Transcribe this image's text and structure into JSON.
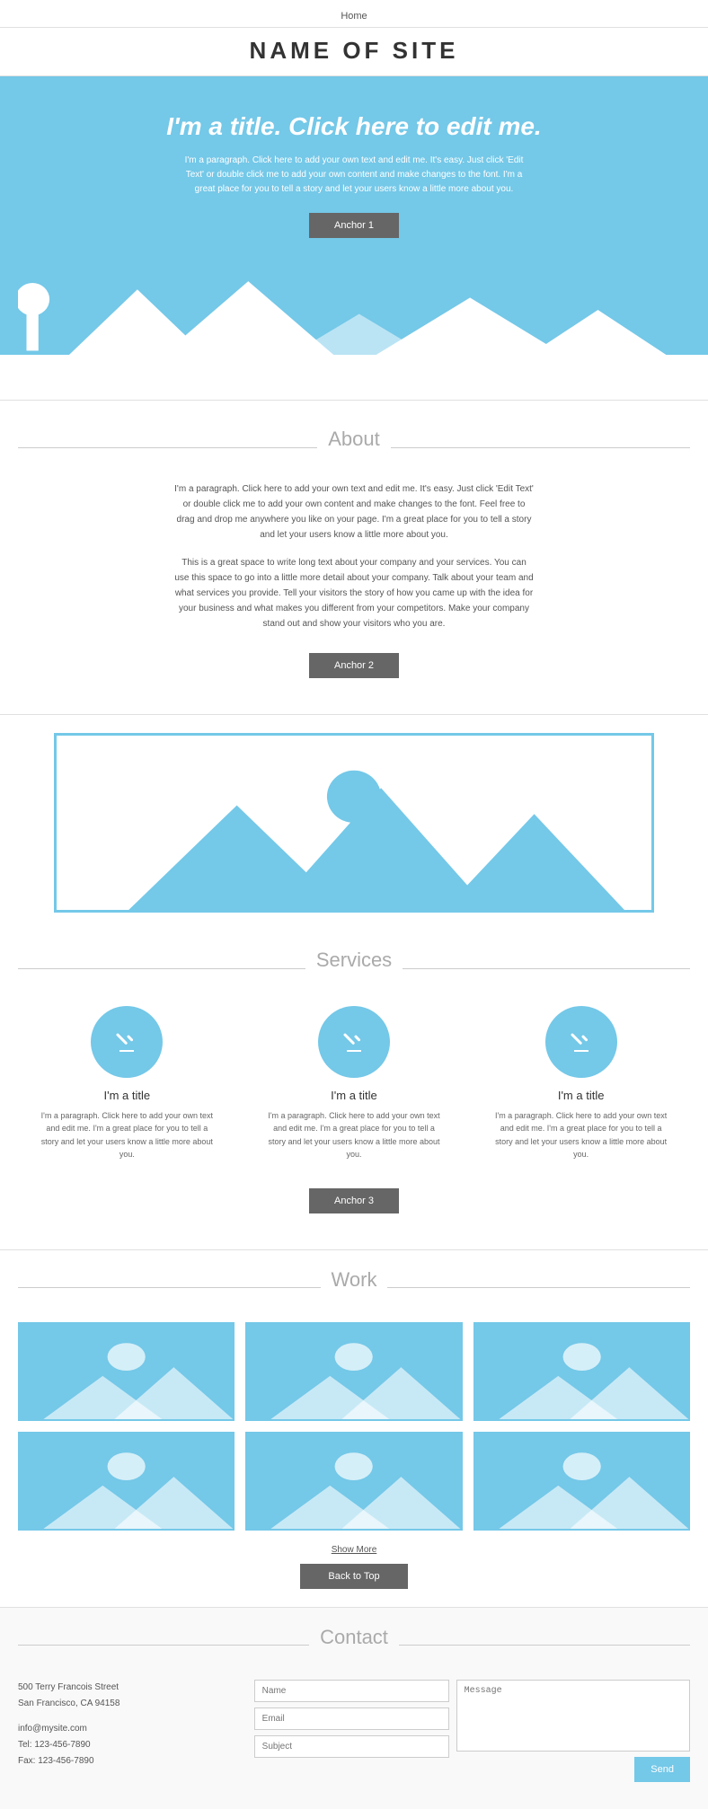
{
  "nav": {
    "home_label": "Home"
  },
  "site": {
    "title": "NAME OF SITE"
  },
  "hero": {
    "title": "I'm a title. Click here to edit me.",
    "paragraph": "I'm a paragraph. Click here to add your own text and edit me. It's easy. Just click 'Edit Text' or double click me to add your own content and make changes to the font. I'm a great place for you to tell a story and let your users know a little more about you.",
    "anchor_label": "Anchor 1"
  },
  "about": {
    "section_title": "About",
    "para1": "I'm a paragraph. Click here to add your own text and edit me. It's easy. Just click 'Edit Text' or double click me to add your own content and make changes to the font. Feel free to drag and drop me anywhere you like on your page. I'm a great place for you to tell a story and let your users know a little more about you.",
    "para2": "This is a great space to write long text about your company and your services. You can use this space to go into a little more detail about your company. Talk about your team and what services you provide. Tell your visitors the story of how you came up with the idea for your business and what makes you different from your competitors. Make your company stand out and show your visitors who you are.",
    "anchor_label": "Anchor 2"
  },
  "services": {
    "section_title": "Services",
    "items": [
      {
        "title": "I'm a title",
        "paragraph": "I'm a paragraph. Click here to add your own text and edit me. I'm a great place for you to tell a story and let your users know a little more about you."
      },
      {
        "title": "I'm a title",
        "paragraph": "I'm a paragraph. Click here to add your own text and edit me. I'm a great place for you to tell a story and let your users know a little more about you."
      },
      {
        "title": "I'm a title",
        "paragraph": "I'm a paragraph. Click here to add your own text and edit me. I'm a great place for you to tell a story and let your users know a little more about you."
      }
    ],
    "anchor_label": "Anchor 3"
  },
  "work": {
    "section_title": "Work",
    "show_more_label": "Show More",
    "back_to_top_label": "Back to Top"
  },
  "contact": {
    "section_title": "Contact",
    "address": "500 Terry Francois Street\nSan Francisco, CA 94158",
    "email": "info@mysite.com",
    "tel": "Tel: 123-456-7890",
    "fax": "Fax: 123-456-7890",
    "name_placeholder": "Name",
    "email_placeholder": "Email",
    "subject_placeholder": "Subject",
    "message_placeholder": "Message",
    "submit_label": "Send"
  },
  "colors": {
    "accent": "#74c8e8",
    "btn_dark": "#666666"
  }
}
